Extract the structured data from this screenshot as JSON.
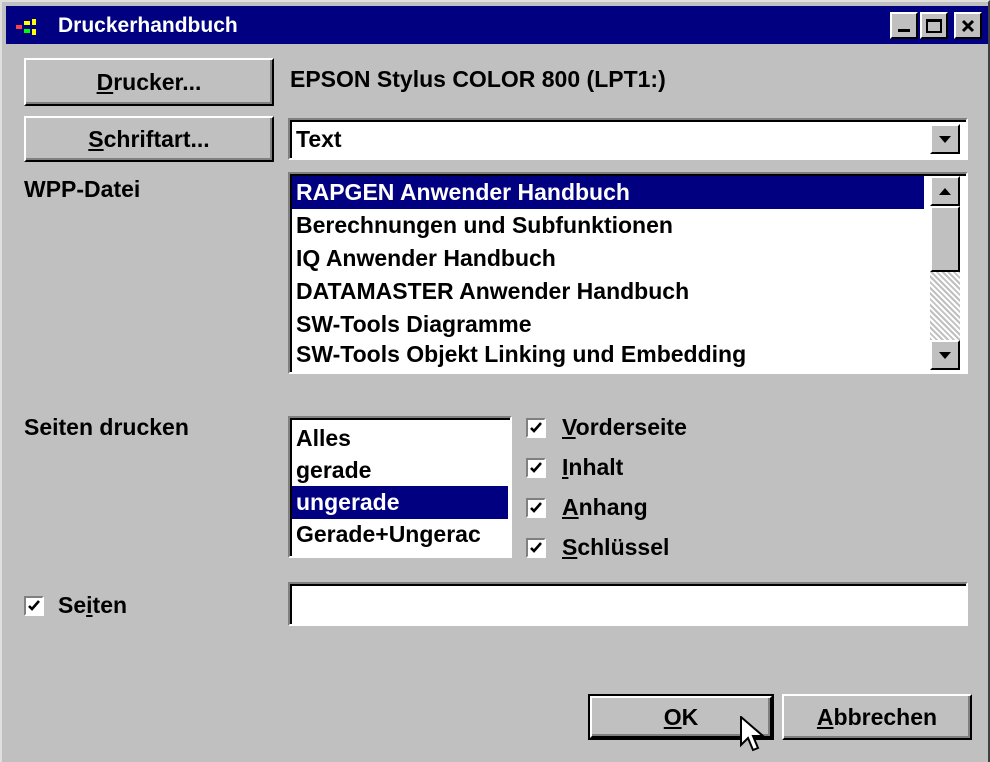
{
  "window": {
    "title": "Druckerhandbuch"
  },
  "printer": {
    "button_pre": "",
    "button_ul": "D",
    "button_post": "rucker...",
    "name": "EPSON Stylus COLOR 800 (LPT1:)"
  },
  "font": {
    "button_pre": "",
    "button_ul": "S",
    "button_post": "chriftart...",
    "value": "Text"
  },
  "wpp": {
    "label": "WPP-Datei",
    "items": [
      "RAPGEN Anwender Handbuch",
      "Berechnungen und Subfunktionen",
      "IQ Anwender Handbuch",
      "DATAMASTER Anwender Handbuch",
      "SW-Tools Diagramme",
      "SW-Tools Objekt Linking und Embedding"
    ],
    "selected_index": 0
  },
  "pages": {
    "label": "Seiten drucken",
    "options": [
      "Alles",
      "gerade",
      "ungerade",
      "Gerade+Ungerac"
    ],
    "selected_index": 2
  },
  "checkboxes": [
    {
      "pre": "",
      "ul": "V",
      "post": "orderseite",
      "checked": true
    },
    {
      "pre": "",
      "ul": "I",
      "post": "nhalt",
      "checked": true
    },
    {
      "pre": "",
      "ul": "A",
      "post": "nhang",
      "checked": true
    },
    {
      "pre": "",
      "ul": "S",
      "post": "chlüssel",
      "checked": true
    }
  ],
  "seiten": {
    "pre": "Se",
    "ul": "i",
    "post": "ten",
    "checked": true,
    "value": ""
  },
  "ok_button": {
    "pre": "",
    "ul": "O",
    "post": "K"
  },
  "cancel_button": {
    "pre": "",
    "ul": "A",
    "post": "bbrechen"
  },
  "colors": {
    "face": "#c0c0c0",
    "title_bg": "#000080",
    "selection": "#000080"
  }
}
